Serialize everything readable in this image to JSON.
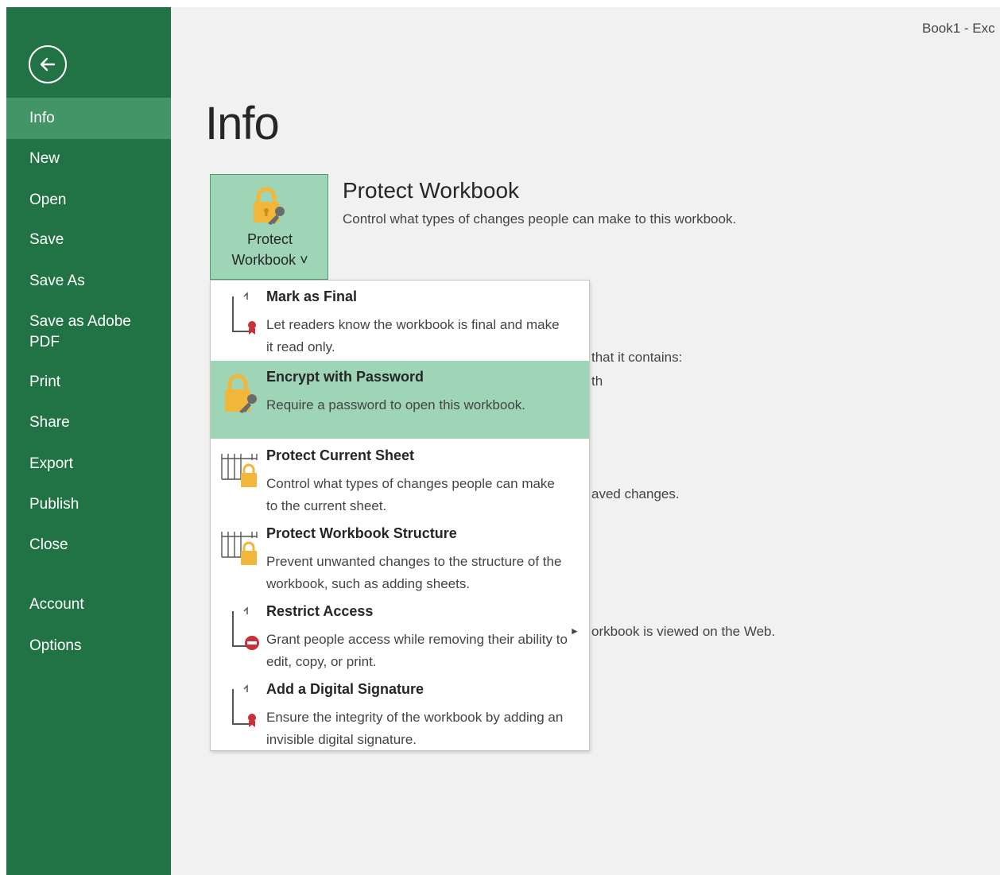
{
  "window": {
    "title": "Book1 - Exc"
  },
  "sidebar": {
    "back_icon": "back-arrow-icon",
    "items": [
      {
        "label": "Info",
        "active": true
      },
      {
        "label": "New"
      },
      {
        "label": "Open"
      },
      {
        "label": "Save"
      },
      {
        "label": "Save As"
      },
      {
        "label": "Save as Adobe PDF"
      },
      {
        "label": "Print"
      },
      {
        "label": "Share"
      },
      {
        "label": "Export"
      },
      {
        "label": "Publish"
      },
      {
        "label": "Close"
      },
      {
        "label": "Account"
      },
      {
        "label": "Options"
      }
    ]
  },
  "main": {
    "title": "Info",
    "protect": {
      "button_line1": "Protect",
      "button_line2": "Workbook ˅",
      "title": "Protect Workbook",
      "description": "Control what types of changes people can make to this workbook."
    },
    "background_fragments": {
      "contains": "that it contains:",
      "th": "th",
      "saved": "aved changes.",
      "web": "orkbook is viewed on the Web."
    }
  },
  "menu": {
    "items": [
      {
        "title": "Mark as Final",
        "desc": "Let readers know the workbook is final and make it read only.",
        "icon": "mark-final-icon"
      },
      {
        "title": "Encrypt with Password",
        "desc": "Require a password to open this workbook.",
        "icon": "lock-key-icon"
      },
      {
        "title": "Protect Current Sheet",
        "desc": "Control what types of changes people can make to the current sheet.",
        "icon": "sheet-lock-icon"
      },
      {
        "title": "Protect Workbook Structure",
        "desc": "Prevent unwanted changes to the structure of the workbook, such as adding sheets.",
        "icon": "structure-lock-icon"
      },
      {
        "title": "Restrict Access",
        "desc": "Grant people access while removing their ability to edit, copy, or print.",
        "icon": "restrict-icon"
      },
      {
        "title": "Add a Digital Signature",
        "desc": "Ensure the integrity of the workbook by adding an invisible digital signature.",
        "icon": "signature-icon"
      }
    ]
  },
  "colors": {
    "sidebar": "#217346",
    "sidebar_active": "#439467",
    "highlight": "#9fd5b7",
    "lock_gold": "#f2b63a"
  }
}
